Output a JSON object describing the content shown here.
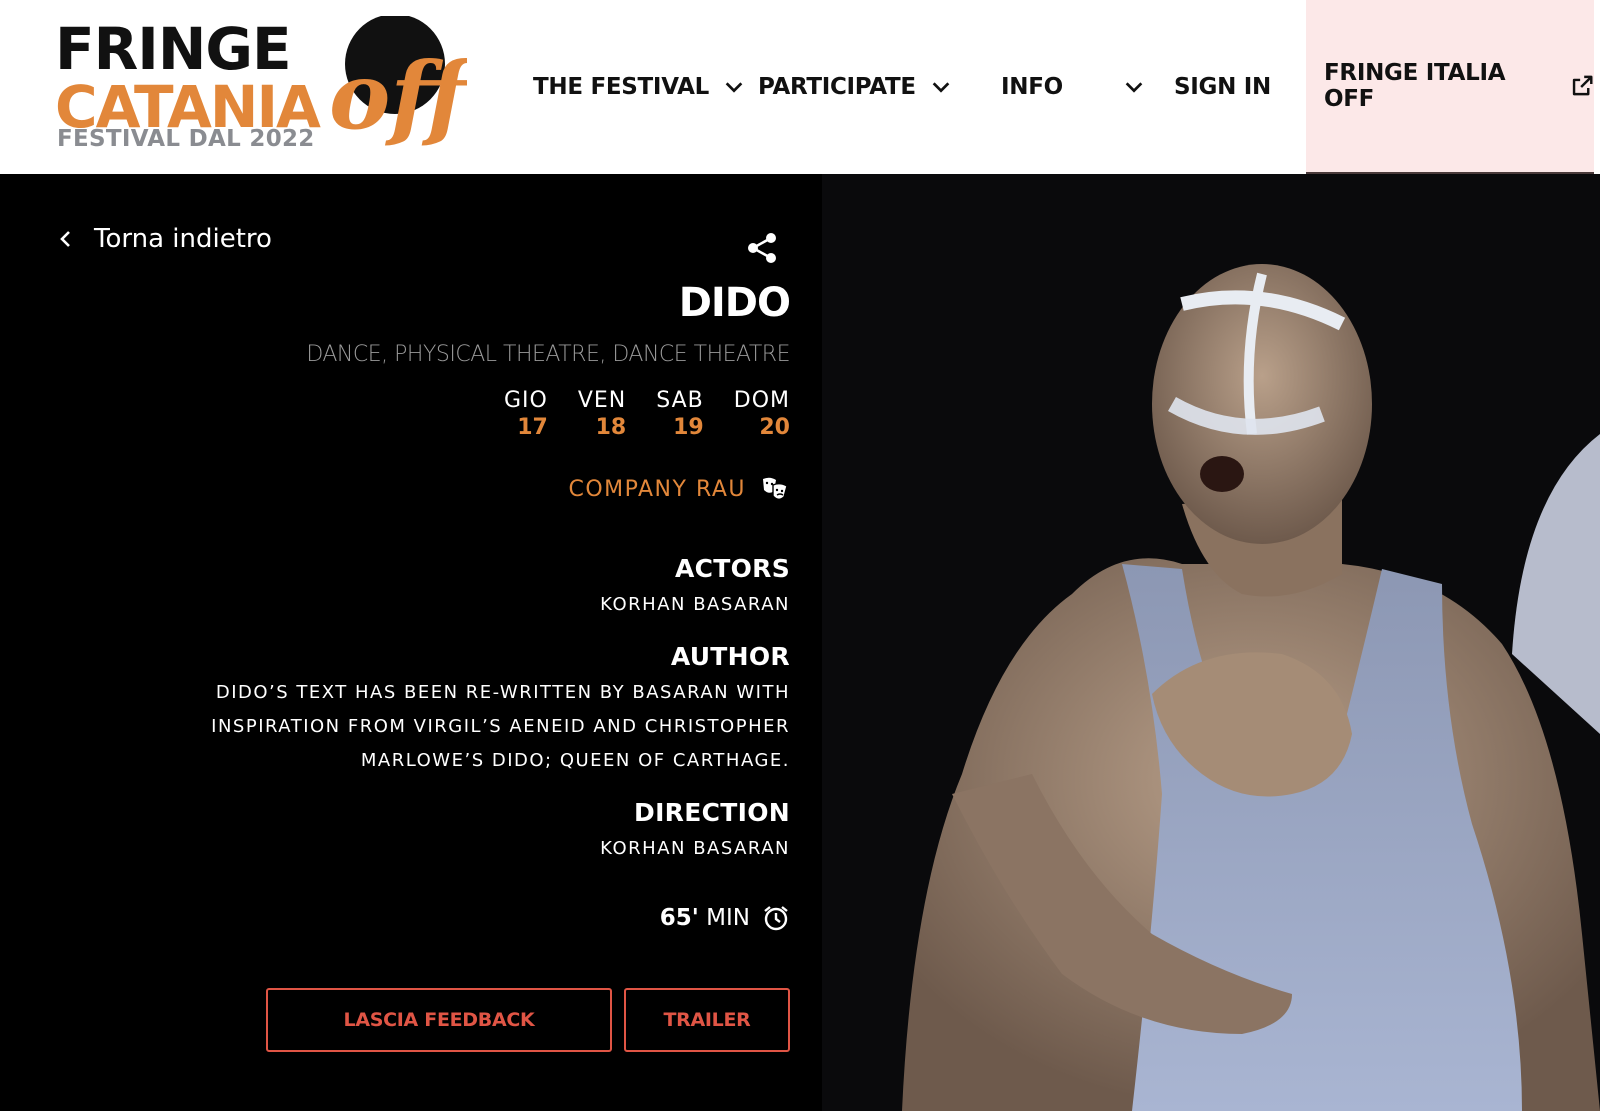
{
  "logo": {
    "line1": "FRINGE",
    "line2": "CATANIA",
    "line3": "FESTIVAL DAL 2022",
    "mark": "off",
    "colors": {
      "black": "#111111",
      "orange": "#e2873a",
      "grey": "#8a8c91"
    }
  },
  "nav": {
    "festival": "THE FESTIVAL",
    "participate": "PARTICIPATE",
    "info": "INFO",
    "signin": "SIGN IN",
    "italia": "FRINGE ITALIA OFF"
  },
  "back": {
    "label": "Torna indietro"
  },
  "show": {
    "title": "DIDO",
    "genres": "DANCE, PHYSICAL THEATRE, DANCE THEATRE",
    "days": [
      {
        "name": "GIO",
        "date": "17"
      },
      {
        "name": "VEN",
        "date": "18"
      },
      {
        "name": "SAB",
        "date": "19"
      },
      {
        "name": "DOM",
        "date": "20"
      }
    ],
    "company": "COMPANY RAU",
    "actors_label": "ACTORS",
    "actors": "KORHAN BASARAN",
    "author_label": "AUTHOR",
    "author": "DIDO’S TEXT HAS BEEN RE-WRITTEN BY BASARAN WITH INSPIRATION FROM VIRGIL’S AENEID AND CHRISTOPHER MARLOWE’S DIDO; QUEEN OF CARTHAGE.",
    "direction_label": "DIRECTION",
    "direction": "KORHAN BASARAN",
    "duration_value": "65'",
    "duration_unit": "MIN"
  },
  "buttons": {
    "feedback": "LASCIA FEEDBACK",
    "trailer": "TRAILER"
  },
  "icons": {
    "chevron": "chevron-down-icon",
    "external": "external-link-icon",
    "back": "chevron-left-icon",
    "share": "share-icon",
    "theatre": "theatre-masks-icon",
    "clock": "alarm-clock-icon"
  },
  "colors": {
    "accent": "#e2873a",
    "button": "#e05545",
    "italia_bg": "#fce8e8"
  }
}
